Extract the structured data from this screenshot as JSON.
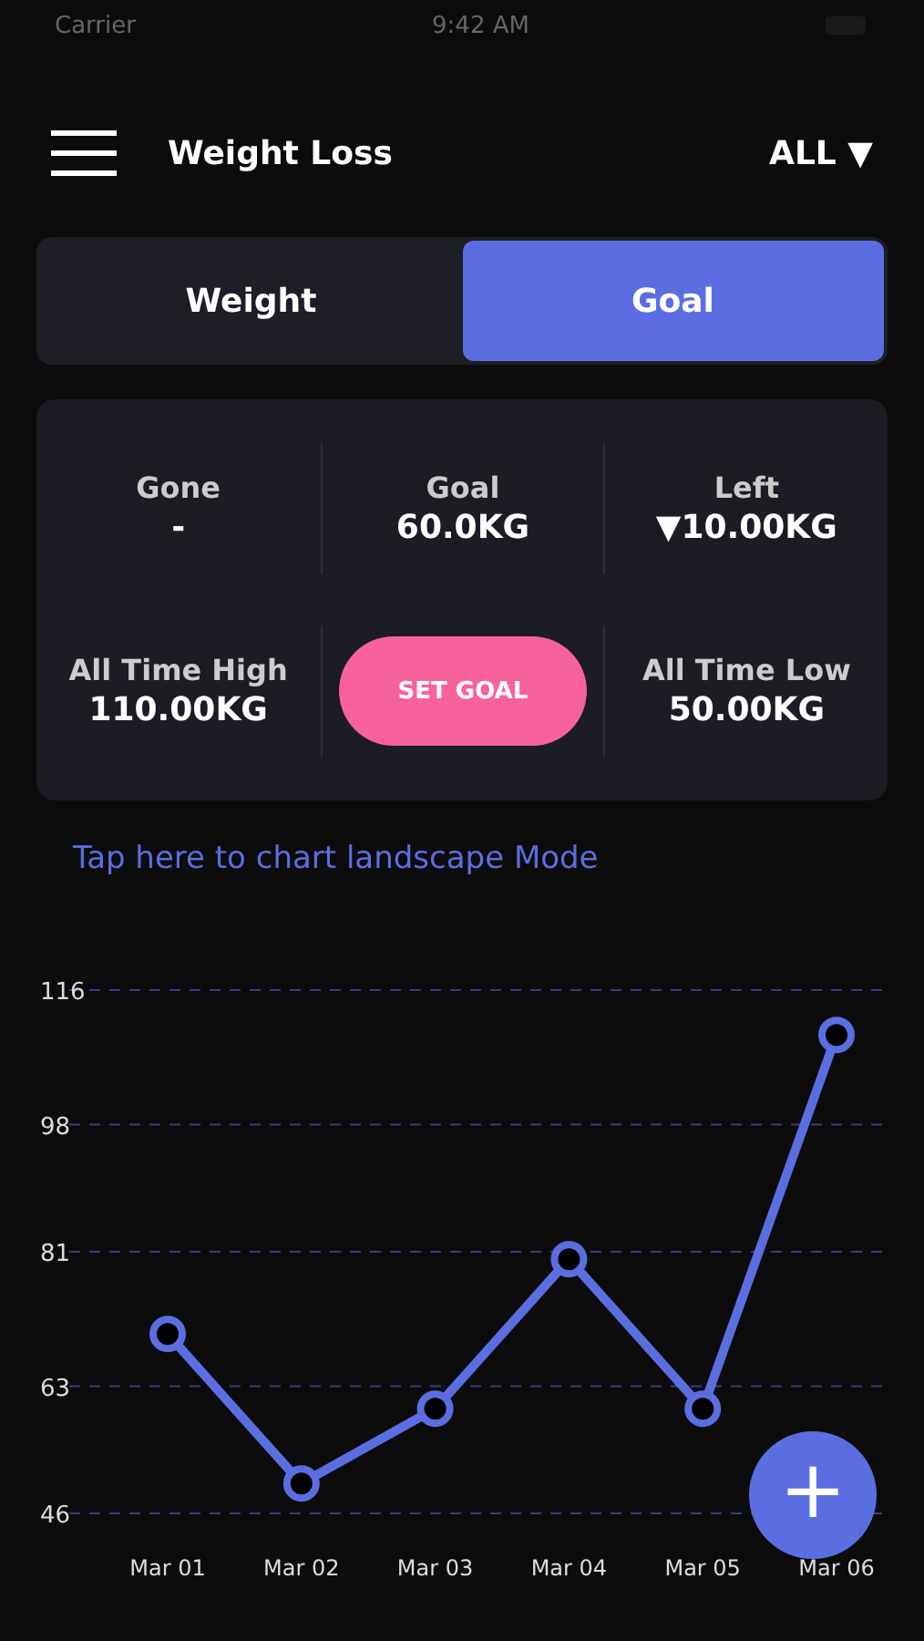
{
  "status_bar": {
    "carrier": "Carrier",
    "time": "9:42 AM"
  },
  "header": {
    "title": "Weight Loss",
    "filter": "ALL ▼"
  },
  "tabs": [
    {
      "label": "Weight",
      "selected": false
    },
    {
      "label": "Goal",
      "selected": true
    }
  ],
  "stats": [
    {
      "label": "Gone",
      "value": "-"
    },
    {
      "label": "Goal",
      "value": "60.0KG"
    },
    {
      "label": "Left",
      "value": "▼10.00KG"
    },
    {
      "label": "All Time High",
      "value": "110.00KG"
    },
    {
      "label": "All Time Low",
      "value": "50.00KG"
    }
  ],
  "set_goal_button": "SET GOAL",
  "landscape_link": "Tap here to chart landscape Mode",
  "chart": {
    "chart_data": {
      "type": "line",
      "categories": [
        "Mar 01",
        "Mar 02",
        "Mar 03",
        "Mar 04",
        "Mar 05",
        "Mar 06"
      ],
      "series": [
        {
          "color": "#5b6ee1",
          "marker": "circle",
          "values": [
            70,
            50,
            60,
            80,
            60,
            110
          ]
        }
      ],
      "ylim": [
        46,
        116
      ],
      "yticks": [
        46,
        63,
        81,
        98,
        116
      ],
      "grid": true
    }
  },
  "fab": "+"
}
